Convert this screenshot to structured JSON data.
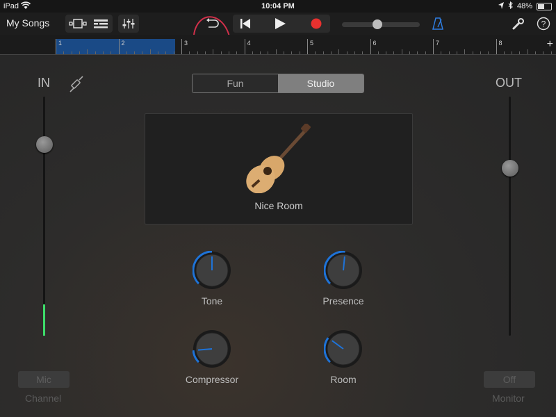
{
  "status": {
    "device": "iPad",
    "time": "10:04 PM",
    "battery": "48%",
    "battery_level": 0.48
  },
  "toolbar": {
    "my_songs": "My Songs",
    "tempo_position": 0.45
  },
  "ruler": {
    "marks": [
      "1",
      "2",
      "3",
      "4",
      "5",
      "6",
      "7",
      "8"
    ],
    "add": "+"
  },
  "input": {
    "label": "IN",
    "slider_level": 0.8,
    "meter_level": 0.13
  },
  "output": {
    "label": "OUT",
    "slider_level": 0.7
  },
  "mode": {
    "fun": "Fun",
    "studio": "Studio",
    "selected": "Studio"
  },
  "preset": {
    "name": "Nice Room",
    "icon": "acoustic-guitar-icon"
  },
  "knobs": [
    {
      "label": "Tone",
      "value": 0.5
    },
    {
      "label": "Presence",
      "value": 0.52
    },
    {
      "label": "Compressor",
      "value": 0.15
    },
    {
      "label": "Room",
      "value": 0.3
    }
  ],
  "bottom": {
    "mic_button": "Mic",
    "channel_label": "Channel",
    "off_button": "Off",
    "monitor_label": "Monitor"
  },
  "colors": {
    "accent": "#1e73d8",
    "record": "#e8312f",
    "level": "#3ddc6a",
    "metronome": "#2f7de0",
    "annotation": "#d0304a"
  }
}
